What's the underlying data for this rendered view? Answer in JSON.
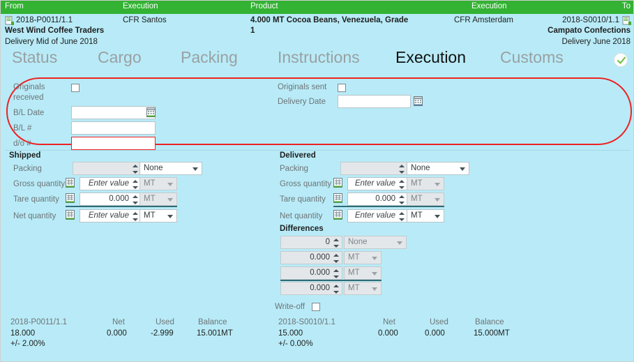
{
  "header": {
    "columns": {
      "from": "From",
      "execution_left": "Execution",
      "product": "Product",
      "execution_right": "Execution",
      "to": "To"
    },
    "from": {
      "ref": "2018-P0011/1.1",
      "party": "West Wind Coffee Traders",
      "delivery": "Delivery Mid of June 2018"
    },
    "execution_left": "CFR Santos",
    "product": {
      "line1": "4.000 MT Cocoa Beans, Venezuela, Grade",
      "line2": "1"
    },
    "execution_right": "CFR Amsterdam",
    "to": {
      "ref": "2018-S0010/1.1",
      "party": "Campato Confections",
      "delivery": "Delivery June 2018"
    }
  },
  "tabs": [
    {
      "label": "Status",
      "active": false
    },
    {
      "label": "Cargo",
      "active": false
    },
    {
      "label": "Packing",
      "active": false
    },
    {
      "label": "Instructions",
      "active": false
    },
    {
      "label": "Execution",
      "active": true
    },
    {
      "label": "Customs",
      "active": false
    }
  ],
  "documents": {
    "originals_received_label": "Originals received",
    "originals_received_checked": false,
    "bl_date_label": "B/L Date",
    "bl_date_value": "",
    "bl_number_label": "B/L #",
    "bl_number_value": "",
    "do_number_label": "d/o #",
    "do_number_value": "",
    "originals_sent_label": "Originals sent",
    "originals_sent_checked": false,
    "delivery_date_label": "Delivery Date",
    "delivery_date_value": ""
  },
  "shipped": {
    "title": "Shipped",
    "rows": [
      {
        "label": "Packing",
        "value": "",
        "unit": "None",
        "value_disabled": true,
        "unit_disabled": false
      },
      {
        "label": "Gross quantity",
        "value": "Enter value",
        "unit": "MT",
        "value_disabled": false,
        "unit_disabled": true
      },
      {
        "label": "Tare quantity",
        "value": "0.000",
        "unit": "MT",
        "value_disabled": false,
        "unit_disabled": true
      },
      {
        "label": "Net quantity",
        "value": "Enter value",
        "unit": "MT",
        "value_disabled": false,
        "unit_disabled": false
      }
    ]
  },
  "delivered": {
    "title": "Delivered",
    "rows": [
      {
        "label": "Packing",
        "value": "",
        "unit": "None",
        "value_disabled": true,
        "unit_disabled": false
      },
      {
        "label": "Gross quantity",
        "value": "Enter value",
        "unit": "MT",
        "value_disabled": false,
        "unit_disabled": true
      },
      {
        "label": "Tare quantity",
        "value": "0.000",
        "unit": "MT",
        "value_disabled": false,
        "unit_disabled": true
      },
      {
        "label": "Net quantity",
        "value": "Enter value",
        "unit": "MT",
        "value_disabled": false,
        "unit_disabled": false
      }
    ]
  },
  "differences": {
    "title": "Differences",
    "rows": [
      {
        "value": "0",
        "unit": "None"
      },
      {
        "value": "0.000",
        "unit": "MT"
      },
      {
        "value": "0.000",
        "unit": "MT"
      },
      {
        "value": "0.000",
        "unit": "MT"
      }
    ],
    "writeoff_label": "Write-off",
    "writeoff_checked": false
  },
  "summary_left": {
    "ref": "2018-P0011/1.1",
    "col_net": "Net",
    "col_used": "Used",
    "col_balance": "Balance",
    "quantity": "18.000",
    "net": "0.000",
    "used": "-2.999",
    "balance": "15.001MT",
    "tolerance": "+/- 2.00%"
  },
  "summary_right": {
    "ref": "2018-S0010/1.1",
    "col_net": "Net",
    "col_used": "Used",
    "col_balance": "Balance",
    "quantity": "15.000",
    "net": "0.000",
    "used": "0.000",
    "balance": "15.000MT",
    "tolerance": "+/- 0.00%"
  },
  "colors": {
    "header_green": "#33b233",
    "body_cyan": "#b8ebf7",
    "error_red": "#ee2222",
    "rule_teal": "#2f6b75"
  }
}
